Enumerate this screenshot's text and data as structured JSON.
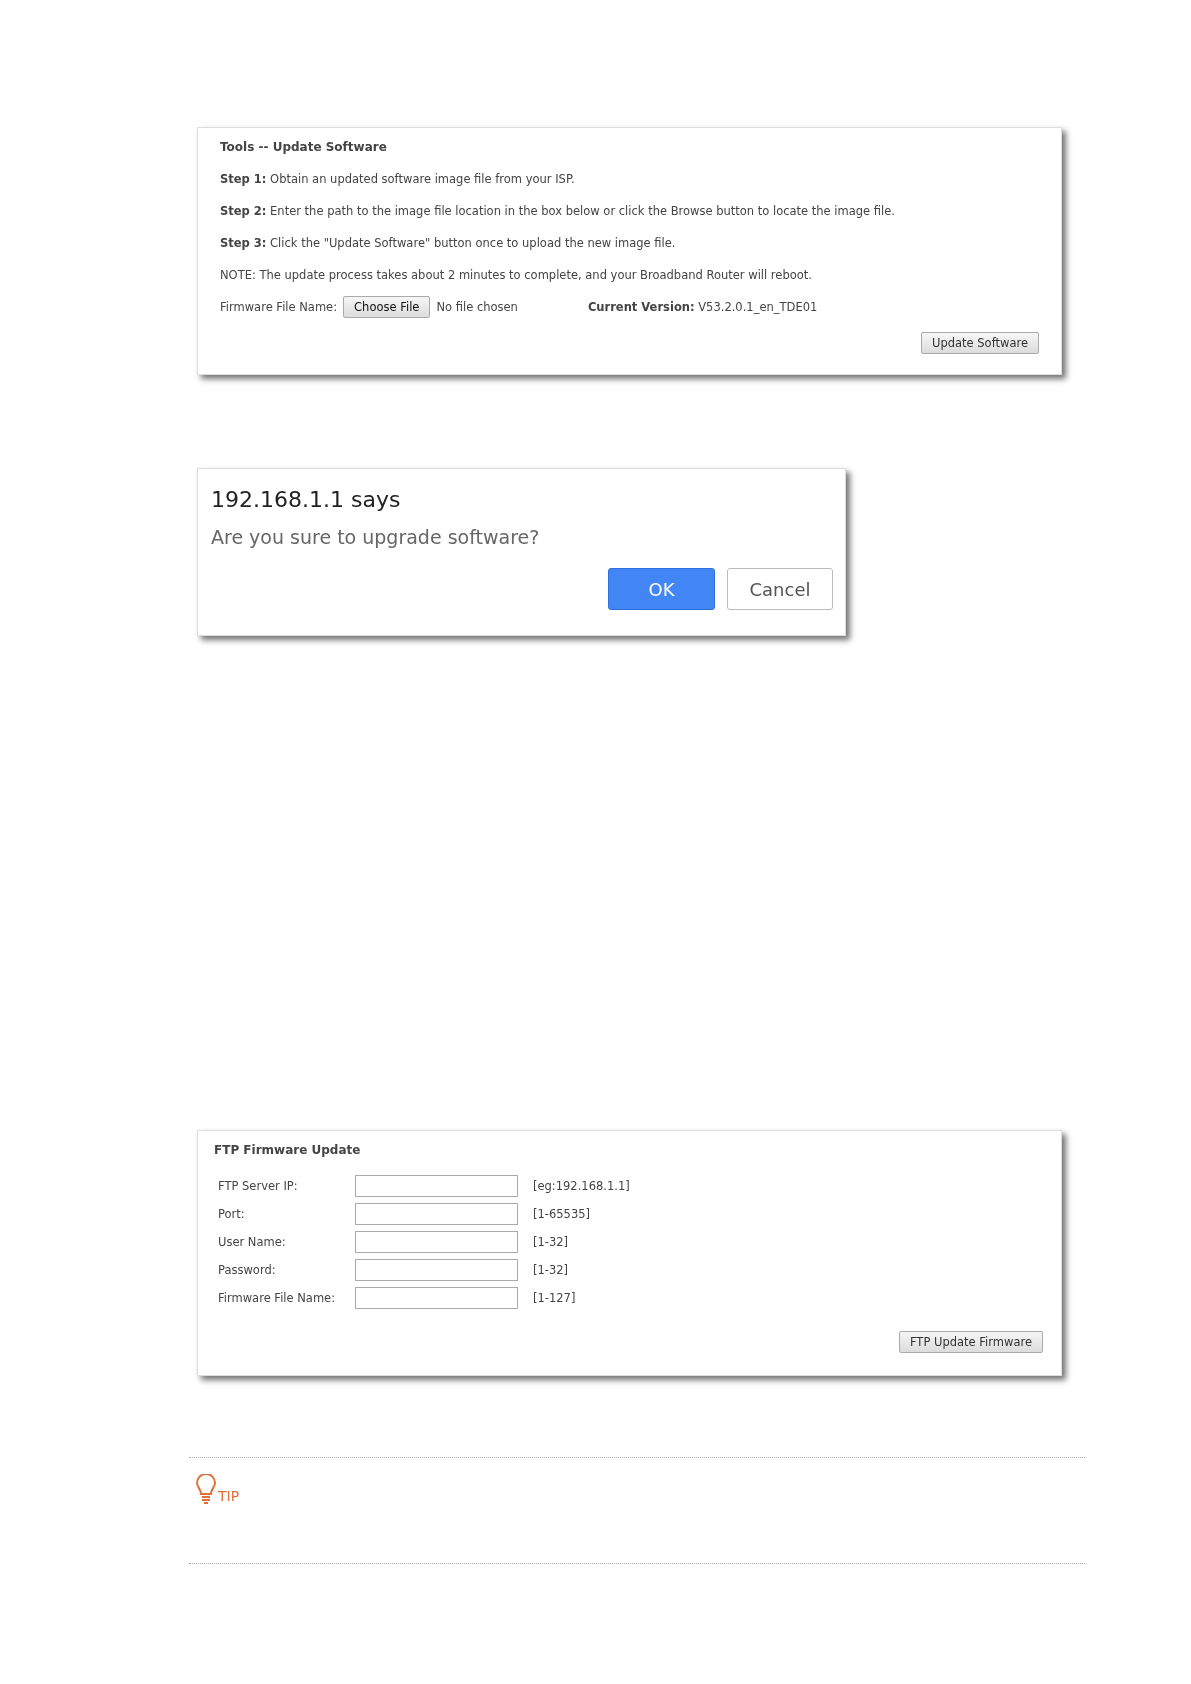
{
  "update_panel": {
    "title": "Tools -- Update Software",
    "steps": [
      "**Step 1:** Obtain an updated software image file from your ISP.",
      "**Step 2:** Enter the path to the image file location in the box below or click the Browse button to locate the image file.",
      "**Step 3:** Click the \"Update Software\" button once to upload the new image file."
    ],
    "note": "NOTE: The update process takes about 2 minutes to complete, and your Broadband Router will reboot.",
    "file_label": "Firmware File Name:",
    "choose_button": "Choose File",
    "file_status": "No file chosen",
    "version": "**Current Version:** V53.2.0.1_en_TDE01",
    "submit_button": "Update Software"
  },
  "dialog": {
    "title": "192.168.1.1 says",
    "message": "Are you sure to upgrade software?",
    "buttons": [
      {
        "label": "OK",
        "kind": "primary"
      },
      {
        "label": "Cancel",
        "kind": "secondary"
      }
    ]
  },
  "ftp_panel": {
    "title": "FTP Firmware Update",
    "fields": [
      {
        "label": "FTP Server IP:",
        "hint": "[eg:192.168.1.1]"
      },
      {
        "label": "Port:",
        "hint": "[1-65535]"
      },
      {
        "label": "User Name:",
        "hint": "[1-32]"
      },
      {
        "label": "Password:",
        "hint": "[1-32]"
      },
      {
        "label": "Firmware File Name:",
        "hint": "[1-127]"
      }
    ],
    "submit_button": "FTP Update Firmware"
  },
  "tip": {
    "label": "TIP"
  }
}
